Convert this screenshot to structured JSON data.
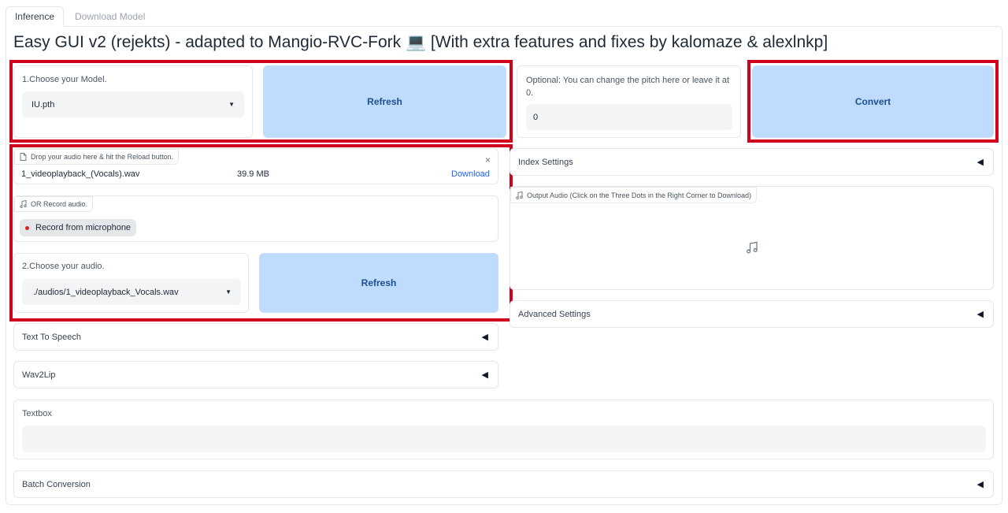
{
  "tabs": [
    {
      "label": "Inference",
      "active": true
    },
    {
      "label": "Download Model",
      "active": false
    }
  ],
  "title": "Easy GUI v2 (rejekts) - adapted to Mangio-RVC-Fork 💻 [With extra features and fixes by kalomaze & alexlnkp]",
  "model": {
    "label": "1.Choose your Model.",
    "selected": "IU.pth",
    "refresh_label": "Refresh"
  },
  "pitch": {
    "label": "Optional: You can change the pitch here or leave it at 0.",
    "value": "0"
  },
  "convert_label": "Convert",
  "upload": {
    "chip_label": "Drop your audio here & hit the Reload button.",
    "filename": "1_videoplayback_(Vocals).wav",
    "size": "39.9 MB",
    "download_label": "Download",
    "clear_glyph": "×"
  },
  "record": {
    "chip_label": "OR Record audio.",
    "button_label": "Record from microphone"
  },
  "audio_select": {
    "label": "2.Choose your audio.",
    "selected": "./audios/1_videoplayback_Vocals.wav",
    "refresh_label": "Refresh"
  },
  "index_settings_label": "Index Settings",
  "output_audio_label": "Output Audio (Click on the Three Dots in the Right Corner to Download)",
  "advanced_settings_label": "Advanced Settings",
  "tts_label": "Text To Speech",
  "wav2lip_label": "Wav2Lip",
  "textbox_label": "Textbox",
  "batch_label": "Batch Conversion",
  "accordion_glyph": "◀",
  "colors": {
    "highlight": "#d0021b",
    "primary_button": "#bfdbfe",
    "primary_text": "#1e4f8f"
  },
  "icons": [
    "file-icon",
    "music-note-icon",
    "record-dot-icon",
    "close-icon",
    "caret-down-icon",
    "collapse-triangle-icon"
  ]
}
